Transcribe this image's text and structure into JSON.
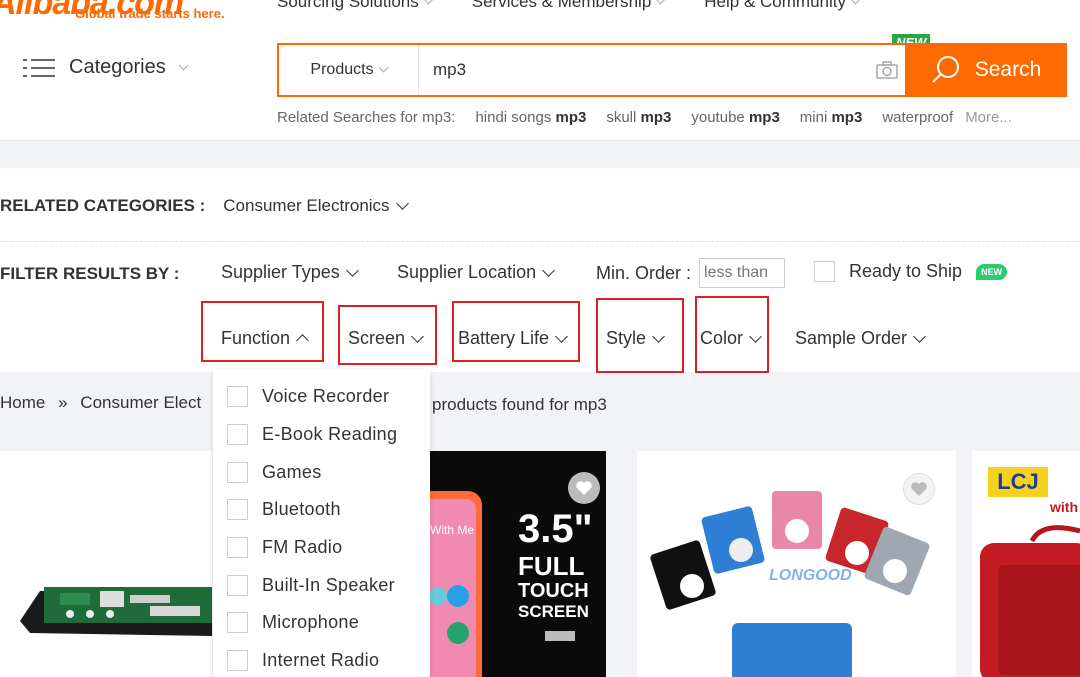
{
  "header": {
    "logo_text": "Alibaba.com",
    "tagline": "Global trade starts here.",
    "nav": [
      "Sourcing Solutions",
      "Services & Membership",
      "Help & Community"
    ],
    "categories_label": "Categories",
    "search": {
      "category": "Products",
      "query": "mp3",
      "button_label": "Search",
      "new_badge": "NEW"
    },
    "related_searches": {
      "label": "Related Searches for mp3:",
      "items": [
        {
          "prefix": "hindi songs",
          "bold": "mp3"
        },
        {
          "prefix": "skull",
          "bold": "mp3"
        },
        {
          "prefix": "youtube",
          "bold": "mp3"
        },
        {
          "prefix": "mini",
          "bold": "mp3"
        },
        {
          "prefix": "waterproof",
          "bold": ""
        }
      ],
      "more": "More..."
    }
  },
  "filters": {
    "related_categories_label": "RELATED CATEGORIES :",
    "related_category": "Consumer Electronics",
    "filter_label": "FILTER RESULTS BY :",
    "supplier_types": "Supplier Types",
    "supplier_location": "Supplier Location",
    "min_order_label": "Min. Order :",
    "min_order_placeholder": "less than",
    "ready_to_ship": "Ready to Ship",
    "ready_to_ship_badge": "NEW",
    "function": "Function",
    "screen": "Screen",
    "battery_life": "Battery Life",
    "style": "Style",
    "color": "Color",
    "sample_order": "Sample Order"
  },
  "breadcrumb": {
    "home": "Home",
    "separator": "»",
    "category": "Consumer Elect",
    "found_text": "products found for mp3"
  },
  "function_dropdown": {
    "options": [
      "Voice Recorder",
      "E-Book Reading",
      "Games",
      "Bluetooth",
      "FM Radio",
      "Built-In Speaker",
      "Microphone",
      "Internet Radio"
    ]
  },
  "products": {
    "card2_lines": [
      "3.5\"",
      "FULL",
      "TOUCH",
      "SCREEN"
    ],
    "card2_phone_text": "With Me",
    "card3_brand": "LONGOOD",
    "card4_brand": "LCJ",
    "card4_text": "with"
  },
  "colors": {
    "accent": "#ff6a00",
    "highlight_box": "#e02020",
    "new_green": "#29a745"
  }
}
